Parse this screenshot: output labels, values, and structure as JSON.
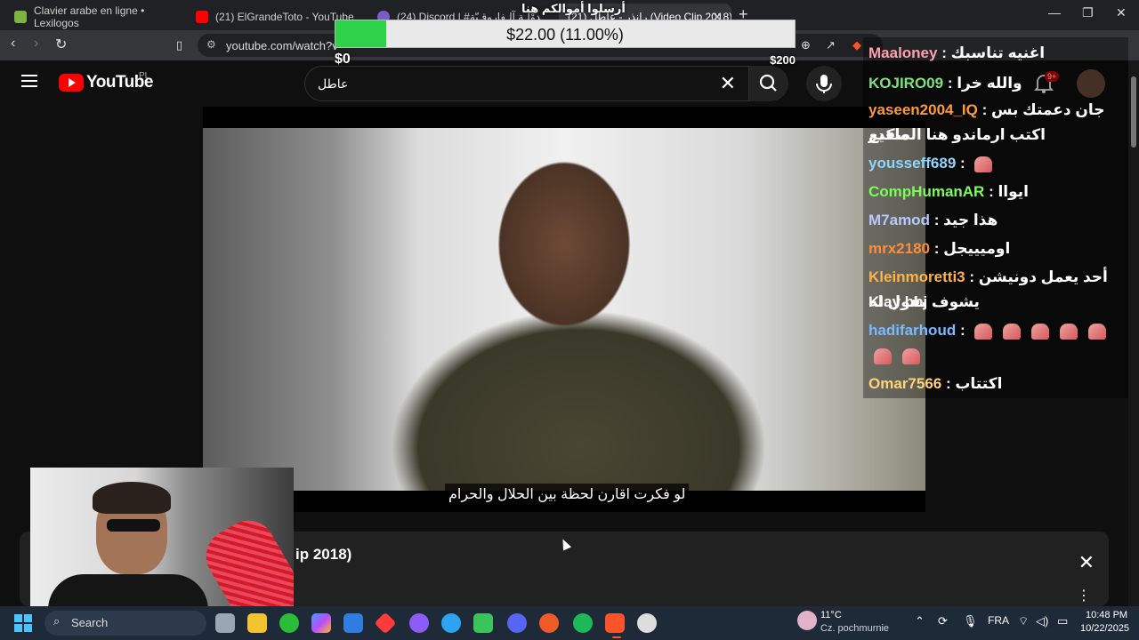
{
  "browser": {
    "tabs": [
      {
        "label": "Clavier arabe en ligne • Lexilogos",
        "fav_color": "#7cb342"
      },
      {
        "label": "(21) ElGrandeToto - YouTube",
        "fav_color": "#ff0000"
      },
      {
        "label": "(24) Discord | #ـدوْلـة آلـفاروقـيّة",
        "fav_color": "#7a5cc7"
      },
      {
        "label": "(21) رانذر - عاطل (Video Clip 2018)",
        "fav_color": "#ff0000"
      }
    ],
    "url": "youtube.com/watch?v="
  },
  "donation": {
    "title": "أرسلوا أموالكم هنا",
    "amount_text": "$22.00 (11.00%)",
    "min_label": "$0",
    "max_label": "$200",
    "progress": 0.11,
    "fill_color": "#2ed34a"
  },
  "youtube": {
    "logo_text": "YouTube",
    "region": "PL",
    "search_query": "عاطل",
    "notifications_badge": "9+",
    "subtitle": "لو فكرت اقارن لحظة بين الحلال والحرام",
    "video_title_fragment": "ip 2018)"
  },
  "chat": [
    {
      "user": "Maaloney",
      "color": "#ff9fb0",
      "msg": "اغنيه تناسبك",
      "emotes": 0
    },
    {
      "user": "KOJIRO09",
      "color": "#7ee07e",
      "msg": "والله خرا",
      "emotes": 0
    },
    {
      "user": "yaseen2004_IQ",
      "color": "#ff9a3c",
      "msg": "جان دعمتك بس ماكدر",
      "emotes": 0
    },
    {
      "user": "",
      "color": "#ffffff",
      "msg": "اكتب ارماندو هنا الصقيع",
      "emotes": 0
    },
    {
      "user": "yousseff689",
      "color": "#8fd6ff",
      "msg": "",
      "emotes": 1
    },
    {
      "user": "CompHumanAR",
      "color": "#7cfc5a",
      "msg": "ايواا",
      "emotes": 0
    },
    {
      "user": "M7amod",
      "color": "#b9c9ff",
      "msg": "هذا جيد",
      "emotes": 0
    },
    {
      "user": "mrx2180",
      "color": "#ff8c3c",
      "msg": "اوميييجل",
      "emotes": 0
    },
    {
      "user": "Kleinmoretti3",
      "color": "#ffb347",
      "msg": "أحد يعمل دونيشن يقول له",
      "emotes": 0
    },
    {
      "user": "",
      "color": "#ffffff",
      "msg": "يشوف Klay bbj",
      "emotes": 0
    },
    {
      "user": "hadifarhoud",
      "color": "#7ab8ff",
      "msg": "",
      "emotes": 5
    },
    {
      "user": "",
      "color": "#ffffff",
      "msg": "",
      "emotes": 2
    },
    {
      "user": "Omar7566",
      "color": "#ffd37a",
      "msg": "اكتتاب",
      "emotes": 0
    }
  ],
  "taskbar": {
    "search_label": "Search",
    "weather_temp": "11°C",
    "weather_desc": "Cz. pochmurnie",
    "language": "FRA",
    "time": "10:48 PM",
    "date": "10/22/2025"
  }
}
